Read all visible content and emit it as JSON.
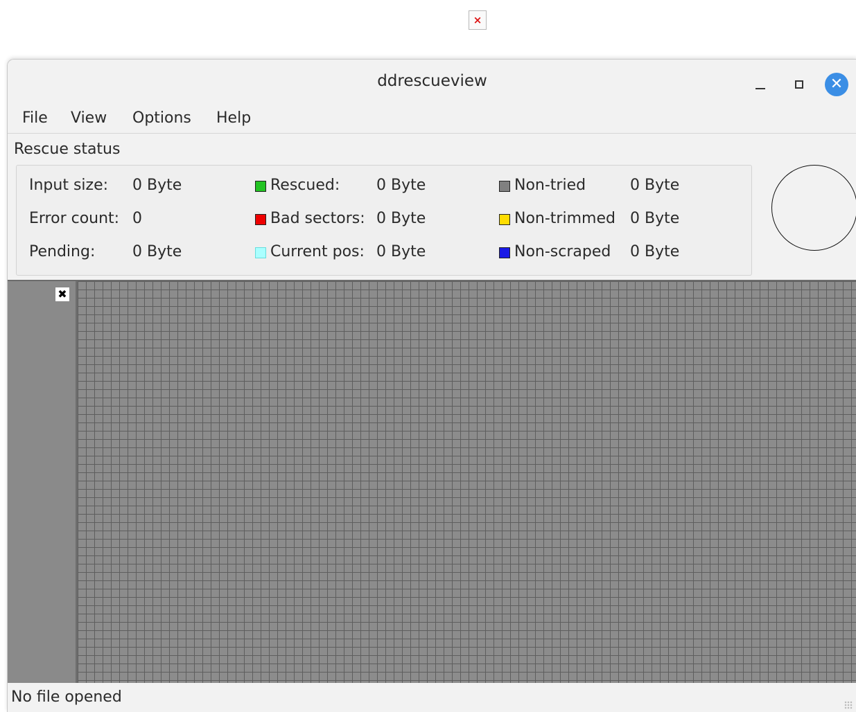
{
  "window": {
    "title": "ddrescueview"
  },
  "menu": [
    "File",
    "View",
    "Options",
    "Help"
  ],
  "group_label": "Rescue status",
  "stats": {
    "input_size": {
      "label": "Input size:",
      "value": "0 Byte"
    },
    "error_count": {
      "label": "Error count:",
      "value": "0"
    },
    "pending": {
      "label": "Pending:",
      "value": "0 Byte"
    },
    "rescued": {
      "label": "Rescued:",
      "value": "0 Byte",
      "color": "#22c322"
    },
    "bad_sectors": {
      "label": "Bad sectors:",
      "value": "0 Byte",
      "color": "#ee0000"
    },
    "current_pos": {
      "label": "Current pos:",
      "value": "0 Byte",
      "color": "#aaffff"
    },
    "non_tried": {
      "label": "Non-tried",
      "value": "0 Byte",
      "color": "#808080"
    },
    "non_trimmed": {
      "label": "Non-trimmed",
      "value": "0 Byte",
      "color": "#ffdd00"
    },
    "non_scraped": {
      "label": "Non-scraped",
      "value": "0 Byte",
      "color": "#1a1ae6"
    }
  },
  "statusbar": {
    "text": "No file opened"
  },
  "icons": {
    "top": "broken-image-icon",
    "map": "broken-image-icon",
    "minimize": "minimize-icon",
    "maximize": "maximize-icon",
    "close": "close-icon"
  }
}
